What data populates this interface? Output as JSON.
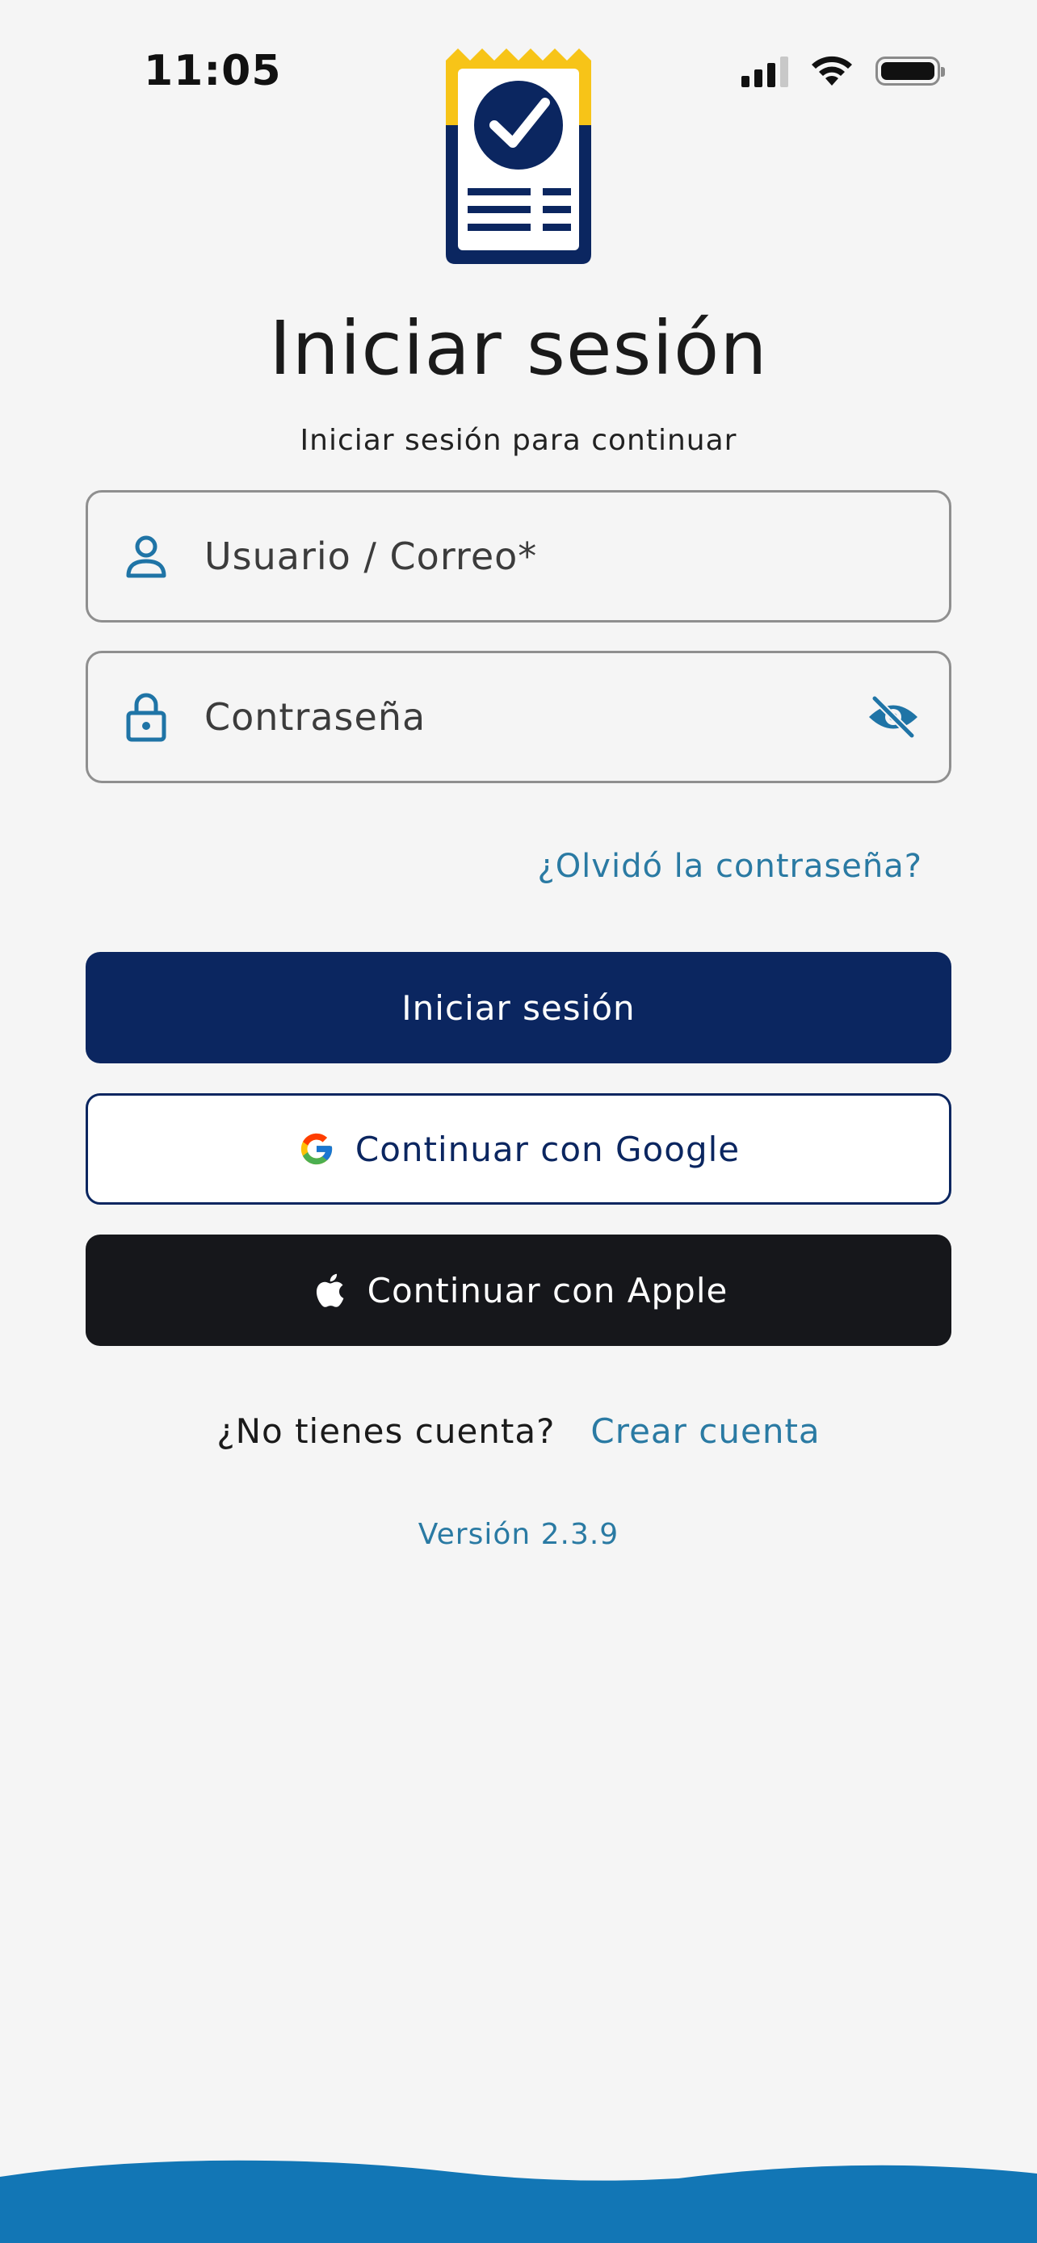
{
  "status_bar": {
    "time": "11:05"
  },
  "header": {
    "title": "Iniciar sesión",
    "subtitle": "Iniciar sesión para continuar"
  },
  "form": {
    "user_placeholder": "Usuario / Correo*",
    "user_value": "",
    "password_placeholder": "Contraseña",
    "password_value": "",
    "forgot_label": "¿Olvidó la contraseña?"
  },
  "buttons": {
    "login_label": "Iniciar sesión",
    "google_label": "Continuar con Google",
    "apple_label": "Continuar con Apple"
  },
  "signup": {
    "question": "¿No tienes cuenta?",
    "link_label": "Crear cuenta"
  },
  "footer": {
    "version": "Versión 2.3.9"
  },
  "icons": {
    "user": "user-icon",
    "lock": "lock-icon",
    "eye_off": "eye-off-icon",
    "google": "google-icon",
    "apple": "apple-icon",
    "logo": "receipt-check-icon"
  },
  "colors": {
    "primary": "#0b2660",
    "accent": "#2a7aa3",
    "logo_yellow": "#f7c418",
    "wave": "#1276b5",
    "apple_button": "#16171b"
  }
}
